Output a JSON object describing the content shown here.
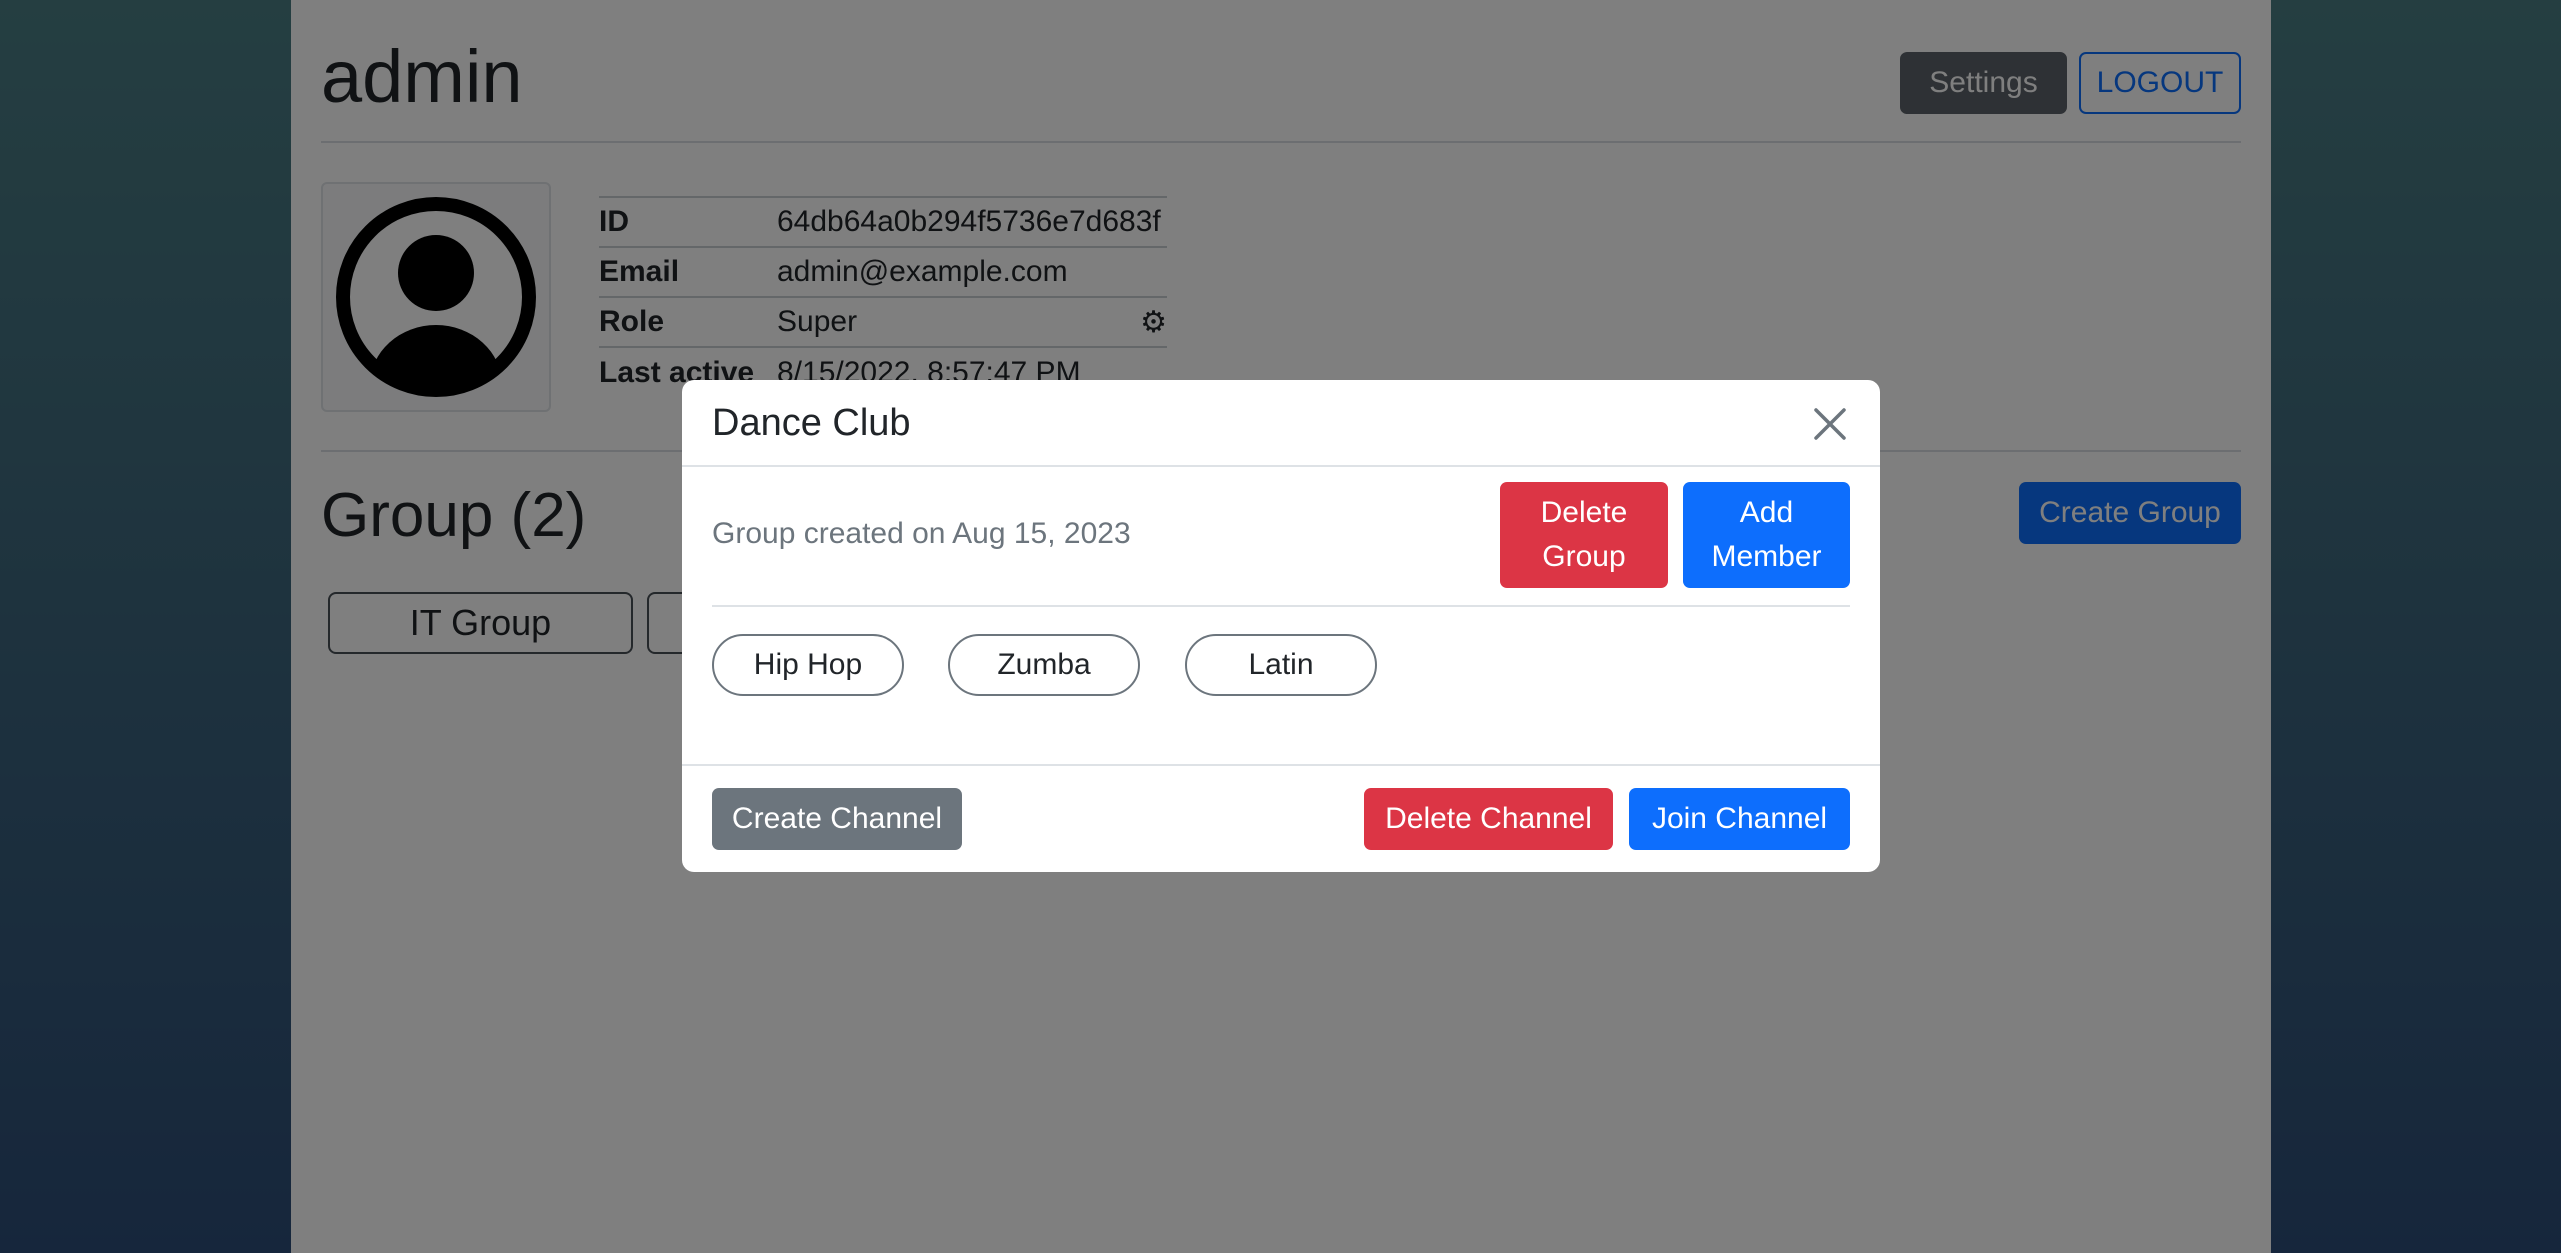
{
  "header": {
    "title": "admin",
    "settings_label": "Settings",
    "logout_label": "LOGOUT"
  },
  "profile": {
    "avatar_icon": "person-circle-icon",
    "rows": [
      {
        "key": "ID",
        "value": "64db64a0b294f5736e7d683f"
      },
      {
        "key": "Email",
        "value": "admin@example.com"
      },
      {
        "key": "Role",
        "value": "Super"
      },
      {
        "key": "Last active",
        "value": "8/15/2022, 8:57:47 PM"
      }
    ],
    "role_settings_icon": "gear-icon"
  },
  "groups": {
    "heading": "Group (2)",
    "create_label": "Create Group",
    "items": [
      {
        "name": "IT Group"
      },
      {
        "name": ""
      }
    ]
  },
  "modal": {
    "title": "Dance Club",
    "close_icon": "close-icon",
    "created_text": "Group created on Aug 15, 2023",
    "delete_group_label": "Delete Group",
    "add_member_label": "Add Member",
    "channels": [
      "Hip Hop",
      "Zumba",
      "Latin"
    ],
    "create_channel_label": "Create Channel",
    "delete_channel_label": "Delete Channel",
    "join_channel_label": "Join Channel"
  },
  "colors": {
    "primary": "#0d6efd",
    "danger": "#dc3545",
    "secondary": "#6c757d",
    "backdrop": "rgba(0,0,0,0.5)"
  }
}
